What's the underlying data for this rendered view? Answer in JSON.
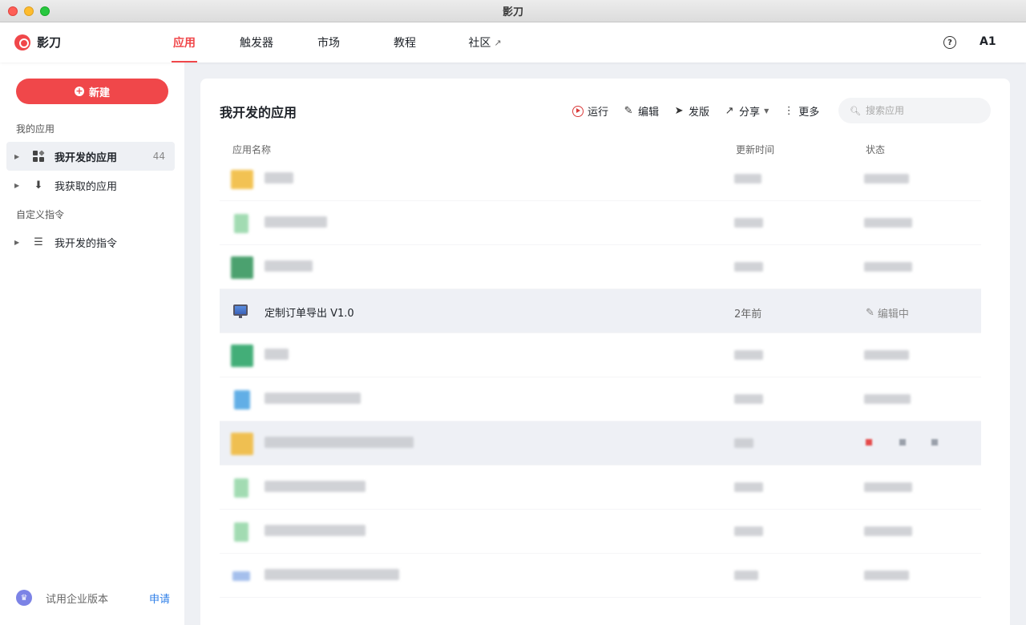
{
  "window": {
    "title": "影刀"
  },
  "brand": {
    "name": "影刀"
  },
  "nav": {
    "tabs": [
      {
        "label": "应用",
        "active": true
      },
      {
        "label": "触发器",
        "active": false
      },
      {
        "label": "市场",
        "active": false
      },
      {
        "label": "教程",
        "active": false
      },
      {
        "label": "社区",
        "active": false,
        "external": true
      }
    ],
    "help_icon": "?",
    "user_initials": "A1"
  },
  "sidebar": {
    "new_button": "新建",
    "section_my_apps": "我的应用",
    "items_apps": [
      {
        "label": "我开发的应用",
        "count": "44",
        "selected": true,
        "icon": "grid-icon"
      },
      {
        "label": "我获取的应用",
        "count": "",
        "selected": false,
        "icon": "download-icon"
      }
    ],
    "section_custom": "自定义指令",
    "items_custom": [
      {
        "label": "我开发的指令",
        "selected": false,
        "icon": "layers-icon"
      }
    ],
    "footer": {
      "label": "试用企业版本",
      "action": "申请"
    }
  },
  "main": {
    "title": "我开发的应用",
    "toolbar": {
      "run": "运行",
      "edit": "编辑",
      "publish": "发版",
      "share": "分享",
      "more": "更多"
    },
    "search": {
      "placeholder": "搜索应用"
    },
    "columns": {
      "name": "应用名称",
      "time": "更新时间",
      "status": "状态"
    },
    "visible_row": {
      "name": "定制订单导出 V1.0",
      "time": "2年前",
      "status": "编辑中"
    }
  },
  "colors": {
    "accent": "#f0474a",
    "link": "#2f7fe8"
  }
}
